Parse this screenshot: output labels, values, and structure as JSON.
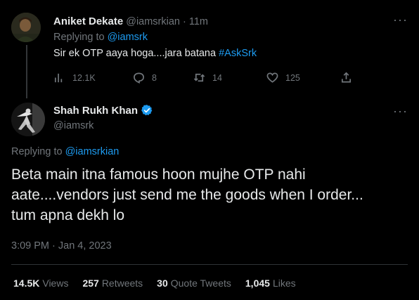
{
  "reply_tweet": {
    "name": "Aniket Dekate",
    "handle": "@iamsrkian",
    "separator": "·",
    "time": "11m",
    "replying_prefix": "Replying to ",
    "replying_mention": "@iamsrk",
    "text": "Sir ek OTP aaya hoga....jara batana ",
    "hashtag": "#AskSrk",
    "more": "···",
    "views": "12.1K",
    "replies": "8",
    "retweets": "14",
    "likes": "125"
  },
  "main_tweet": {
    "name": "Shah Rukh Khan",
    "handle": "@iamsrk",
    "more": "···",
    "replying_prefix": "Replying to ",
    "replying_mention": "@iamsrkian",
    "text_line1": "Beta main itna famous hoon mujhe OTP nahi",
    "text_line2": "aate....vendors just send me the goods when I order...",
    "text_line3": "tum apna dekh lo",
    "timestamp": "3:09 PM · Jan 4, 2023"
  },
  "stats": {
    "views_value": "14.5K",
    "views_label": "Views",
    "retweets_value": "257",
    "retweets_label": "Retweets",
    "quotes_value": "30",
    "quotes_label": "Quote Tweets",
    "likes_value": "1,045",
    "likes_label": "Likes"
  },
  "colors": {
    "background": "#000000",
    "text": "#e7e9ea",
    "muted": "#71767b",
    "accent": "#1d9bf0"
  }
}
